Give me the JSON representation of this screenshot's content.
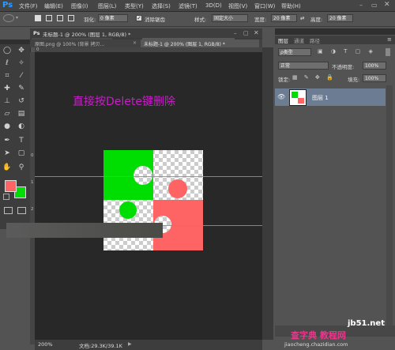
{
  "menu": [
    "文件(F)",
    "编辑(E)",
    "图像(I)",
    "图层(L)",
    "类型(Y)",
    "选择(S)",
    "滤镜(T)",
    "3D(D)",
    "视图(V)",
    "窗口(W)",
    "帮助(H)"
  ],
  "logo": "Ps",
  "options": {
    "feather_label": "羽化:",
    "feather_value": "0 像素",
    "antialias_label": "消除锯齿",
    "style_label": "样式:",
    "style_value": "固定大小",
    "width_label": "宽度:",
    "width_value": "20 像素",
    "swap": "⇄",
    "height_label": "高度:",
    "height_value": "20 像素"
  },
  "tabs": [
    {
      "label": "原图.png @ 100% (背景 拷贝..."
    },
    {
      "label": "未标题-1 @ 200% (图层 1, RGB/8) *"
    }
  ],
  "window": {
    "title": "未标题-1 @ 200% (图层 1, RGB/8) *"
  },
  "ruler": {
    "top_marks": [
      "0"
    ],
    "left_marks": [
      "0",
      "1",
      "2"
    ]
  },
  "canvas": {
    "annotation": "直接按Delete键删除",
    "annotation_color": "#c51fc5",
    "green": "#00dd00",
    "red": "#ff6464",
    "guide_color": "#2ab7c9"
  },
  "status": {
    "zoom": "200%",
    "doc": "文档:29.3K/39.1K"
  },
  "panel": {
    "tabs": [
      "图层",
      "通道",
      "路径"
    ],
    "filter_label": "ρ类型",
    "blend_mode": "正常",
    "opacity_label": "不透明度:",
    "opacity_value": "100%",
    "lock_label": "锁定:",
    "fill_label": "填充:",
    "fill_value": "100%",
    "layer_name": "图层 1"
  },
  "watermark": {
    "line1": "jb51.net",
    "line2": "查字典 教程网",
    "line3": "jiaocheng.chazidian.com"
  }
}
